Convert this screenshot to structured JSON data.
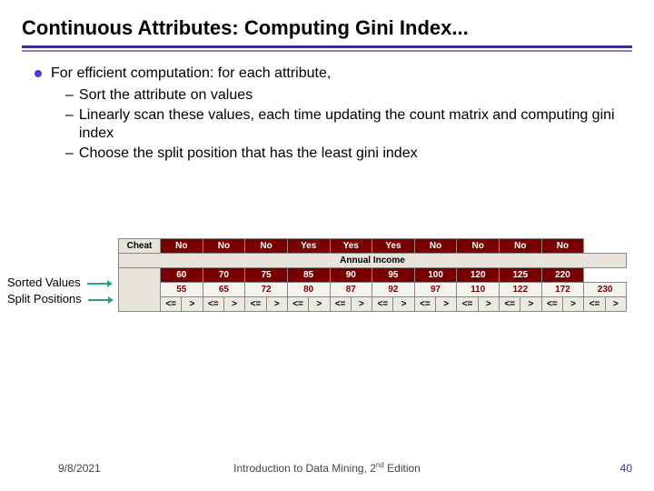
{
  "title": "Continuous Attributes: Computing Gini Index...",
  "bullets": {
    "main": "For efficient computation: for each attribute,",
    "s1": "Sort the attribute on values",
    "s2": "Linearly scan these values, each time updating the count matrix and computing gini index",
    "s3": "Choose the split position that has the least gini index"
  },
  "labels": {
    "cheat": "Cheat",
    "annual_income": "Annual Income",
    "sorted_values": "Sorted Values",
    "split_positions": "Split Positions"
  },
  "chart_data": {
    "type": "table",
    "cheat_row": [
      "No",
      "No",
      "No",
      "Yes",
      "Yes",
      "Yes",
      "No",
      "No",
      "No",
      "No"
    ],
    "sorted_values": [
      60,
      70,
      75,
      85,
      90,
      95,
      100,
      120,
      125,
      220
    ],
    "split_positions": [
      55,
      65,
      72,
      80,
      87,
      92,
      97,
      110,
      122,
      172,
      230
    ],
    "split_headers": [
      "<=",
      ">",
      "<=",
      ">",
      "<=",
      ">",
      "<=",
      ">",
      "<=",
      ">",
      "<=",
      ">",
      "<=",
      ">",
      "<=",
      ">",
      "<=",
      ">",
      "<=",
      ">",
      "<=",
      ">"
    ]
  },
  "footer": {
    "date": "9/8/2021",
    "center_a": "Introduction to Data Mining, 2",
    "center_sup": "nd",
    "center_b": " Edition",
    "page": "40"
  }
}
